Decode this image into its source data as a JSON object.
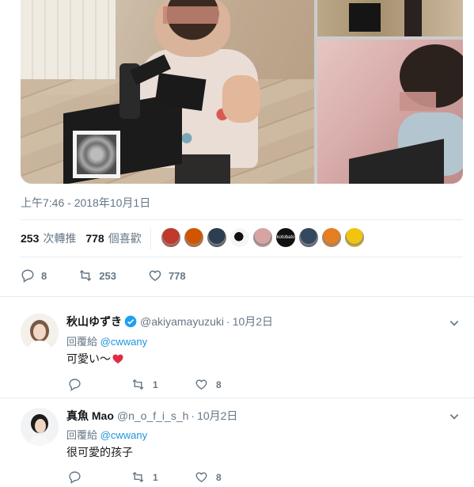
{
  "tweet": {
    "timestamp": "上午7:46 - 2018年10月1日",
    "stats": {
      "retweets_count": "253",
      "retweets_label": "次轉推",
      "likes_count": "778",
      "likes_label": "個喜歡"
    },
    "likers": [
      {
        "icon": "avatar-red-figure",
        "color": "#c0392b"
      },
      {
        "icon": "avatar-red-pattern",
        "color": "#d35400"
      },
      {
        "icon": "avatar-dark-person",
        "color": "#2c3e50"
      },
      {
        "icon": "avatar-black-white-cartoon",
        "color": "#f5f5f5"
      },
      {
        "icon": "avatar-pink-character",
        "color": "#d7a3a3"
      },
      {
        "icon": "avatar-kotobato",
        "color": "#111111",
        "text": "kotobato"
      },
      {
        "icon": "avatar-blue-figure",
        "color": "#34495e"
      },
      {
        "icon": "avatar-colorful-mosaic",
        "color": "#e67e22"
      },
      {
        "icon": "avatar-yellow-cartoon",
        "color": "#f1c40f"
      }
    ],
    "actions": {
      "reply_count": "8",
      "retweet_count": "253",
      "like_count": "778"
    }
  },
  "replies": [
    {
      "name": "秋山ゆずき",
      "verified": true,
      "handle": "@akiyamayuzuki",
      "time": "10月2日",
      "reply_to_label": "回覆給",
      "reply_to_handle": "@cwwany",
      "text": "可愛い〜",
      "has_heart_emoji": true,
      "reply_count": "",
      "retweet_count": "1",
      "like_count": "8"
    },
    {
      "name": "真魚 Mao",
      "verified": false,
      "handle": "@n_o_f_i_s_h",
      "time": "10月2日",
      "reply_to_label": "回覆給",
      "reply_to_handle": "@cwwany",
      "text": "很可愛的孩子",
      "has_heart_emoji": false,
      "reply_count": "",
      "retweet_count": "1",
      "like_count": "8"
    }
  ],
  "colors": {
    "accent": "#1b95e0",
    "muted": "#657786",
    "text": "#14171a",
    "divider": "#e6ecf0",
    "heart": "#e0245e"
  }
}
